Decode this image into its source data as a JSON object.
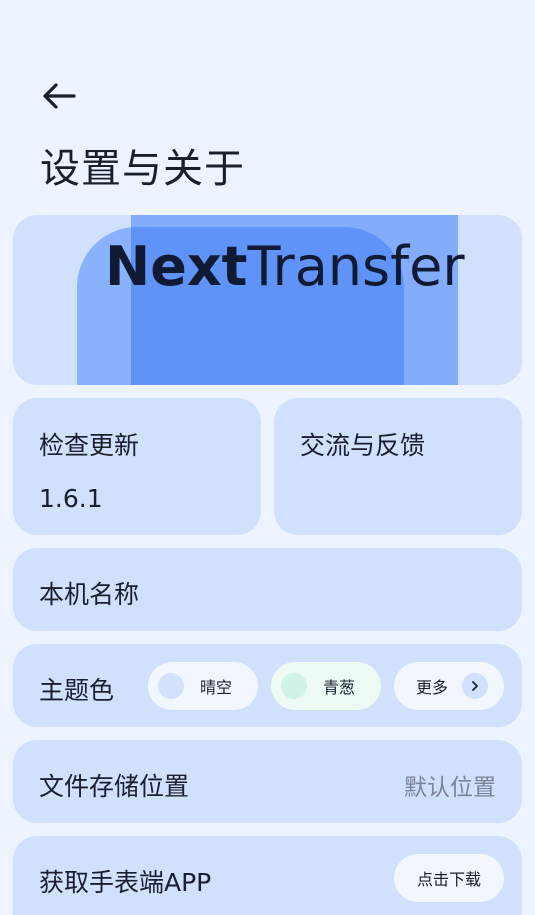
{
  "header": {
    "back_icon": "arrow-left-icon",
    "title": "设置与关于"
  },
  "banner": {
    "brand_bold": "Next",
    "brand_regular": "Transfer"
  },
  "update": {
    "label": "检查更新",
    "version": "1.6.1"
  },
  "feedback": {
    "label": "交流与反馈"
  },
  "device_name": {
    "label": "本机名称"
  },
  "theme": {
    "label": "主题色",
    "options": [
      {
        "name": "晴空",
        "color": "#d3e1fb",
        "pill_color": "#f2f6ff"
      },
      {
        "name": "青葱",
        "color": "#d1f3e4",
        "pill_color": "#edfbf4"
      }
    ],
    "more_label": "更多",
    "more_icon": "chevron-right-icon"
  },
  "storage": {
    "label": "文件存储位置",
    "value": "默认位置"
  },
  "watch_app": {
    "label": "获取手表端APP",
    "button": "点击下载"
  }
}
